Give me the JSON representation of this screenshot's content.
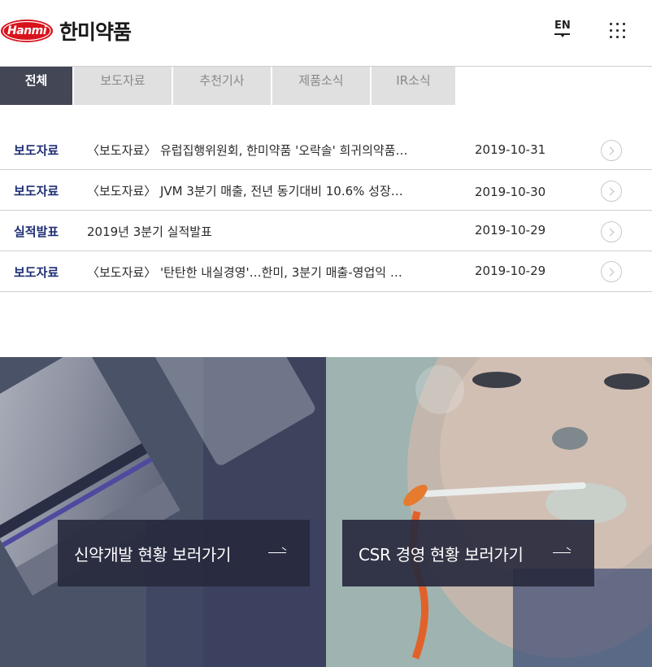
{
  "header": {
    "logo_badge": "Hanmi",
    "logo_name": "한미약품",
    "lang_label": "EN"
  },
  "tabs": [
    {
      "label": "전체",
      "active": true
    },
    {
      "label": "보도자료",
      "active": false
    },
    {
      "label": "추천기사",
      "active": false
    },
    {
      "label": "제품소식",
      "active": false
    },
    {
      "label": "IR소식",
      "active": false
    }
  ],
  "news": [
    {
      "category": "보도자료",
      "title": "〈보도자료〉 유럽집행위원회, 한미약품 '오락솔' 희귀의약품…",
      "date": "2019-10-31"
    },
    {
      "category": "보도자료",
      "title": "〈보도자료〉 JVM 3분기 매출, 전년 동기대비 10.6% 성장…",
      "date": "2019-10-30"
    },
    {
      "category": "실적발표",
      "title": "2019년 3분기 실적발표",
      "date": "2019-10-29"
    },
    {
      "category": "보도자료",
      "title": "〈보도자료〉 '탄탄한 내실경영'…한미, 3분기 매출-영업익 …",
      "date": "2019-10-29"
    }
  ],
  "banners": [
    {
      "label": "신약개발 현황 보러가기"
    },
    {
      "label": "CSR 경영 현황 보러가기"
    }
  ],
  "colors": {
    "brand_red": "#d8121b",
    "category_navy": "#1f2e74",
    "active_tab": "#434655",
    "banner_box": "#282a3e"
  }
}
